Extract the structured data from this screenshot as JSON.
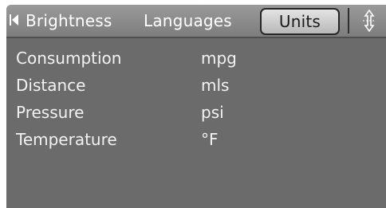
{
  "header": {
    "tabs": [
      {
        "label": "Brightness",
        "active": false
      },
      {
        "label": "Languages",
        "active": false
      },
      {
        "label": "Units",
        "active": true
      }
    ],
    "back_icon": "left-arrow-icon",
    "scroll_icon": "up-down-arrows-icon"
  },
  "settings": {
    "items": [
      {
        "label": "Consumption",
        "value": "mpg"
      },
      {
        "label": "Distance",
        "value": "mls"
      },
      {
        "label": "Pressure",
        "value": "psi"
      },
      {
        "label": "Temperature",
        "value": "°F"
      }
    ]
  },
  "colors": {
    "panel": "#6b6b6b",
    "tabbar": "#8a8a8a",
    "active_tab": "#d0d0d0",
    "text": "#ffffff"
  }
}
